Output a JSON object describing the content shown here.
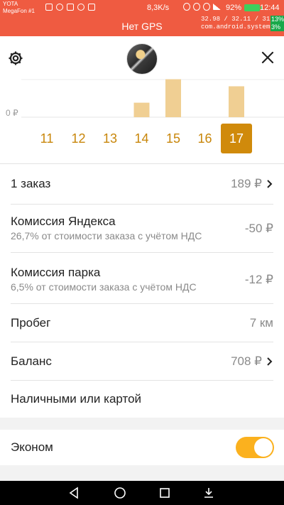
{
  "status_bar": {
    "carrier_line1": "YOTA",
    "carrier_line2": "MegaFon #1",
    "speed": "8,3K/s",
    "battery_percent": "92%",
    "time": "12:44"
  },
  "gps_banner": {
    "title": "Нет GPS"
  },
  "debug_overlay": {
    "line1": "32.98 / 32.11 / 31.91",
    "line2": "com.android.systemui",
    "side_line1": "13%",
    "side_line2": "3%"
  },
  "header": {
    "settings_icon": "gear-icon",
    "close_icon": "close-icon"
  },
  "chart_data": {
    "type": "bar",
    "ytick_labels": [
      "0 ₽"
    ],
    "categories": [
      "11",
      "12",
      "13",
      "14",
      "15",
      "16",
      "17"
    ],
    "values": [
      0,
      0,
      0,
      189,
      495,
      0,
      403
    ],
    "selected": "17",
    "bar_color": "#f0cf93"
  },
  "summary": {
    "orders_label": "1 заказ",
    "orders_value": "189 ₽",
    "yandex_commission_label": "Комиссия Яндекса",
    "yandex_commission_sub": "26,7% от стоимости заказа с учётом НДС",
    "yandex_commission_value": "-50 ₽",
    "park_commission_label": "Комиссия парка",
    "park_commission_sub": "6,5% от стоимости заказа с учётом НДС",
    "park_commission_value": "-12 ₽",
    "mileage_label": "Пробег",
    "mileage_value": "7 км",
    "balance_label": "Баланс",
    "balance_value": "708 ₽",
    "payment_label": "Наличными или картой"
  },
  "tariff": {
    "label": "Эконом",
    "enabled": true
  },
  "colors": {
    "accent": "#fbb11e",
    "banner": "#ef5b41",
    "selected_day": "#d08a0b"
  }
}
